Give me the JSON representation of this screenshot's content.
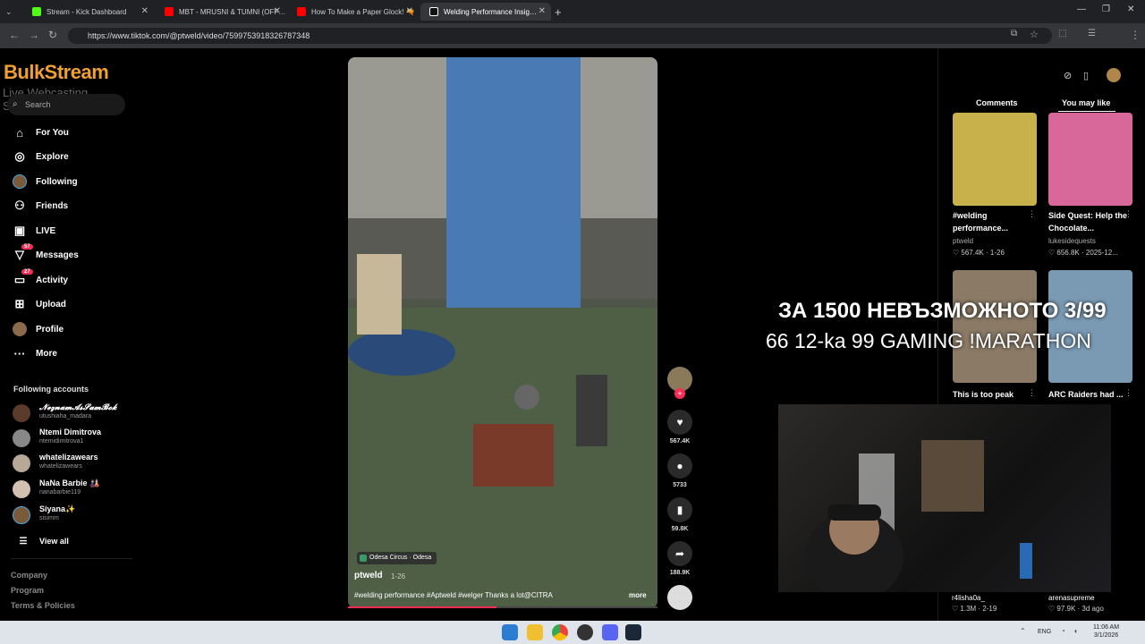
{
  "browser": {
    "tabs": [
      {
        "title": "Stream - Kick Dashboard",
        "color": "#53fc18"
      },
      {
        "title": "MBT - MRUSNI & TUMNI (OFF…",
        "color": "#ff0000"
      },
      {
        "title": "How To Make a Paper Glock! 🔫",
        "color": "#ff0000"
      },
      {
        "title": "Welding Performance Insig…",
        "color": "#ffffff"
      }
    ],
    "url": "https://www.tiktok.com/@ptweld/video/7599753918326787348"
  },
  "sidebar": {
    "logo": "BulkStream",
    "logo_sub": "Live Webcasting Services",
    "search_placeholder": "Search",
    "nav": [
      {
        "label": "For You",
        "icon": "home-icon"
      },
      {
        "label": "Explore",
        "icon": "compass-icon"
      },
      {
        "label": "Following",
        "icon": "following-avatar-icon"
      },
      {
        "label": "Friends",
        "icon": "friends-icon"
      },
      {
        "label": "LIVE",
        "icon": "live-icon"
      },
      {
        "label": "Messages",
        "icon": "messages-icon",
        "badge": "57"
      },
      {
        "label": "Activity",
        "icon": "activity-icon",
        "badge": "27"
      },
      {
        "label": "Upload",
        "icon": "upload-icon"
      },
      {
        "label": "Profile",
        "icon": "profile-icon"
      },
      {
        "label": "More",
        "icon": "more-icon"
      }
    ],
    "following_header": "Following accounts",
    "accounts": [
      {
        "name": "𝓝𝓮𝔃𝓷𝓪𝓶𝓐𝓼𝓢𝓪𝓶𝓑𝓸𝓴",
        "user": "utushiaha_madara"
      },
      {
        "name": "Ntemi Dimitrova",
        "user": "ntemidimitrova1"
      },
      {
        "name": "whatelizawears",
        "user": "whatelizawears"
      },
      {
        "name": "NaNa Barbie 🎎",
        "user": "nanabarbie119"
      },
      {
        "name": "Siyana✨",
        "user": "sisimm"
      }
    ],
    "view_all": "View all",
    "footer": [
      "Company",
      "Program",
      "Terms & Policies"
    ]
  },
  "video": {
    "location": "Odesa Circus · Odesa",
    "author": "ptweld",
    "date": "1-26",
    "caption": "#welding performance #Aptweld #welger Thanks a lot@CITRA",
    "more": "more",
    "progress": 0.48,
    "likes": "567.4K",
    "comments": "5733",
    "saves": "59.8K",
    "shares": "188.9K"
  },
  "right_panel": {
    "tab_comments": "Comments",
    "tab_you_may_like": "You may like",
    "cards": [
      {
        "title": "#welding performance...",
        "author": "ptweld",
        "likes": "567.4K",
        "date": "1-26",
        "color": "#c8b04a"
      },
      {
        "title": "Side Quest: Help the Chocolate...",
        "author": "lukesidequests",
        "likes": "656.8K",
        "date": "2025-12...",
        "color": "#d8689a"
      },
      {
        "title": "This is too peak",
        "author": "r4lisha0a_",
        "likes": "1.3M",
        "date": "2-19",
        "color": "#8a7a66"
      },
      {
        "title": "ARC Raiders had ...",
        "author": "arenasupreme",
        "likes": "97.9K",
        "date": "3d ago",
        "color": "#7a9ab4"
      }
    ]
  },
  "overlay": {
    "line1": "ЗА 1500 НЕВЪЗМОЖНОТО 3/99",
    "line2": "66 12-ka 99 GAMING !MARATHON"
  },
  "taskbar": {
    "lang": "ENG",
    "time": "11:06 AM",
    "date": "3/1/2026"
  }
}
